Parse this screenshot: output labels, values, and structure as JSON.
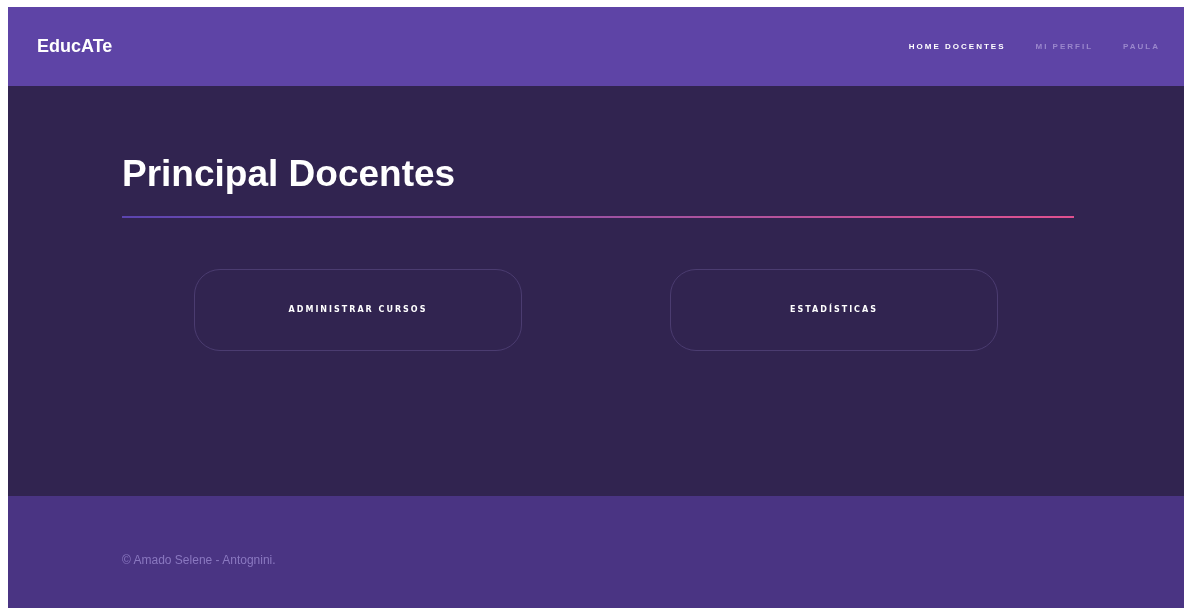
{
  "brand": "EducATe",
  "nav": [
    {
      "label": "HOME DOCENTES",
      "selected": true
    },
    {
      "label": "MI PERFIL",
      "selected": false
    },
    {
      "label": "PAULA",
      "selected": false
    }
  ],
  "title": "Principal Docentes",
  "cards": [
    {
      "label": "ADMINISTRAR CURSOS"
    },
    {
      "label": "ESTADÍSTICAS"
    }
  ],
  "footer": "© Amado Selene - Antognini."
}
